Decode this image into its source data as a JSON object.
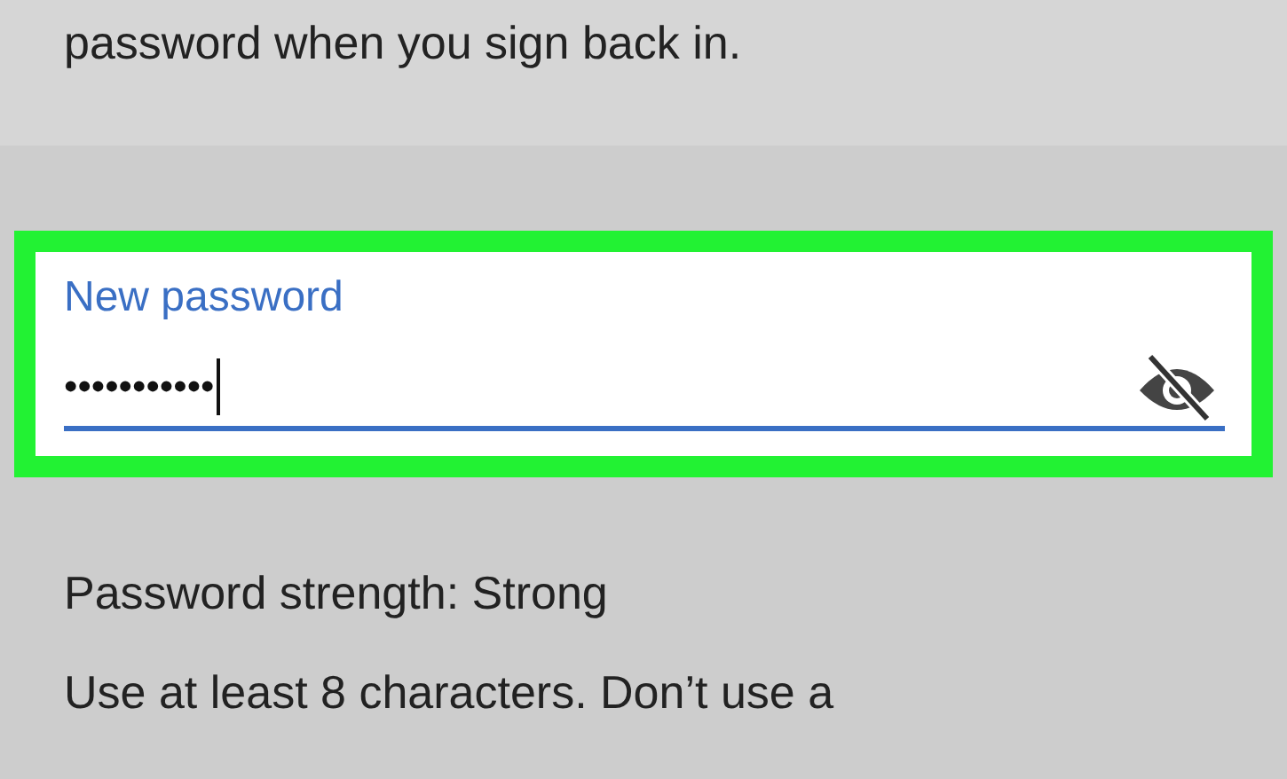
{
  "intro_text": "password when you sign back in.",
  "password_field": {
    "label": "New password",
    "value": "•••••••••••",
    "focused": true,
    "highlighted": true,
    "visibility_toggle": true
  },
  "strength": {
    "label": "Password strength:",
    "value": "Strong"
  },
  "hint_text": "Use at least 8 characters. Don’t use a"
}
